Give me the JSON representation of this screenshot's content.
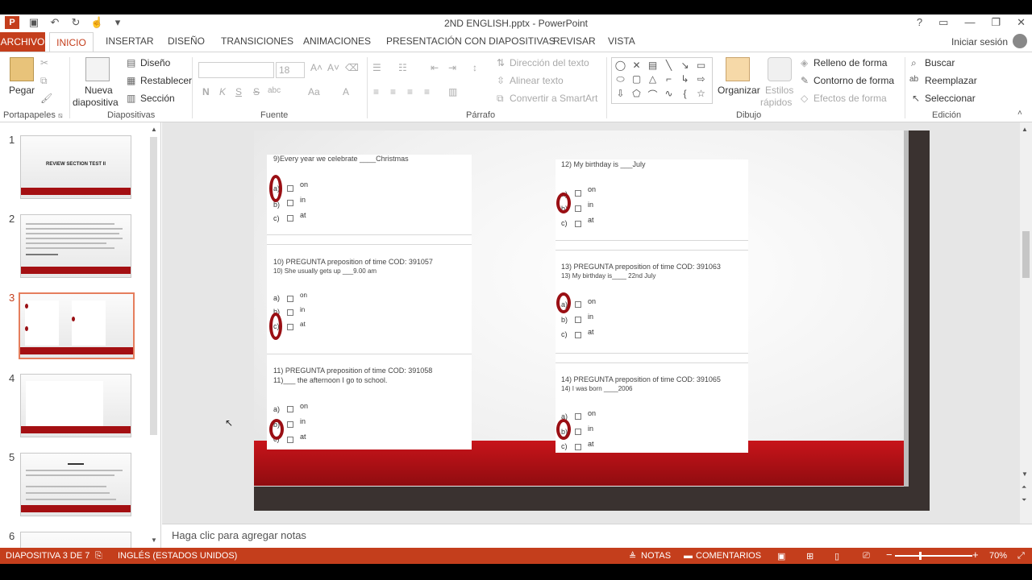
{
  "window": {
    "title": "2ND ENGLISH.pptx - PowerPoint",
    "app_logo": "P",
    "controls": [
      "?",
      "▭",
      "—",
      "❐",
      "✕"
    ]
  },
  "qat": {
    "icons": [
      "save-icon",
      "undo-icon",
      "redo-icon",
      "touch-mode-icon",
      "customize-icon"
    ]
  },
  "tabs": {
    "file": "ARCHIVO",
    "active": "INICIO",
    "items": [
      "INSERTAR",
      "DISEÑO",
      "TRANSICIONES",
      "ANIMACIONES",
      "PRESENTACIÓN CON DIAPOSITIVAS",
      "REVISAR",
      "VISTA"
    ],
    "signin": "Iniciar sesión"
  },
  "ribbon": {
    "clipboard": {
      "paste": "Pegar",
      "label": "Portapapeles"
    },
    "slides": {
      "new_slide_1": "Nueva",
      "new_slide_2": "diapositiva",
      "layout": "Diseño",
      "reset": "Restablecer",
      "section": "Sección",
      "label": "Diapositivas"
    },
    "font": {
      "font_size": "18",
      "bold": "N",
      "italic": "K",
      "underline": "S",
      "strike": "S",
      "spacing": "abc",
      "case": "Aa",
      "color": "A",
      "label": "Fuente"
    },
    "paragraph": {
      "text_direction": "Dirección del texto",
      "align_text": "Alinear texto",
      "smartart": "Convertir a SmartArt",
      "label": "Párrafo"
    },
    "drawing": {
      "arrange": "Organizar",
      "quick_styles_1": "Estilos",
      "quick_styles_2": "rápidos",
      "fill": "Relleno de forma",
      "outline": "Contorno de forma",
      "effects": "Efectos de forma",
      "label": "Dibujo"
    },
    "editing": {
      "find": "Buscar",
      "replace": "Reemplazar",
      "select": "Seleccionar",
      "label": "Edición"
    }
  },
  "thumbnails": {
    "numbers": [
      "1",
      "2",
      "3",
      "4",
      "5",
      "6"
    ],
    "slide1_title": "REVIEW SECTION TEST II",
    "selected": 3
  },
  "slide": {
    "left": [
      {
        "title": "9)Every year we celebrate ____Christmas",
        "subtitle": "",
        "options": [
          "on",
          "in",
          "at"
        ],
        "letters": [
          "a)",
          "b)",
          "c)"
        ]
      },
      {
        "title": "10) PREGUNTA preposition of time COD: 391057",
        "subtitle": "10) She usually gets up ___9.00 am",
        "options": [
          "on",
          "in",
          "at"
        ],
        "letters": [
          "a)",
          "b)",
          "c)"
        ]
      },
      {
        "title": "11) PREGUNTA preposition of time COD: 391058",
        "subtitle": "11)___ the afternoon I go to school.",
        "options": [
          "on",
          "in",
          "at"
        ],
        "letters": [
          "a)",
          "b)",
          "c)"
        ]
      }
    ],
    "right": [
      {
        "title": "12) My birthday is ___July",
        "subtitle": "",
        "options": [
          "on",
          "in",
          "at"
        ],
        "letters": [
          "a)",
          "b)",
          "c)"
        ]
      },
      {
        "title": "13) PREGUNTA preposition of time COD: 391063",
        "subtitle": "13) My birthday is____ 22nd July",
        "options": [
          "on",
          "in",
          "at"
        ],
        "letters": [
          "a)",
          "b)",
          "c)"
        ]
      },
      {
        "title": "14) PREGUNTA preposition of time COD: 391065",
        "subtitle": "14) I was born ____2006",
        "options": [
          "on",
          "in",
          "at"
        ],
        "letters": [
          "a)",
          "b)",
          "c)"
        ]
      }
    ],
    "accent_color": "#9a0f14"
  },
  "notes": {
    "placeholder": "Haga clic para agregar notas"
  },
  "status": {
    "slide_info": "DIAPOSITIVA 3 DE 7",
    "language": "INGLÉS (ESTADOS UNIDOS)",
    "notes": "NOTAS",
    "comments": "COMENTARIOS",
    "zoom": "70%",
    "minus": "−",
    "plus": "+",
    "color": "#c43e1c"
  }
}
